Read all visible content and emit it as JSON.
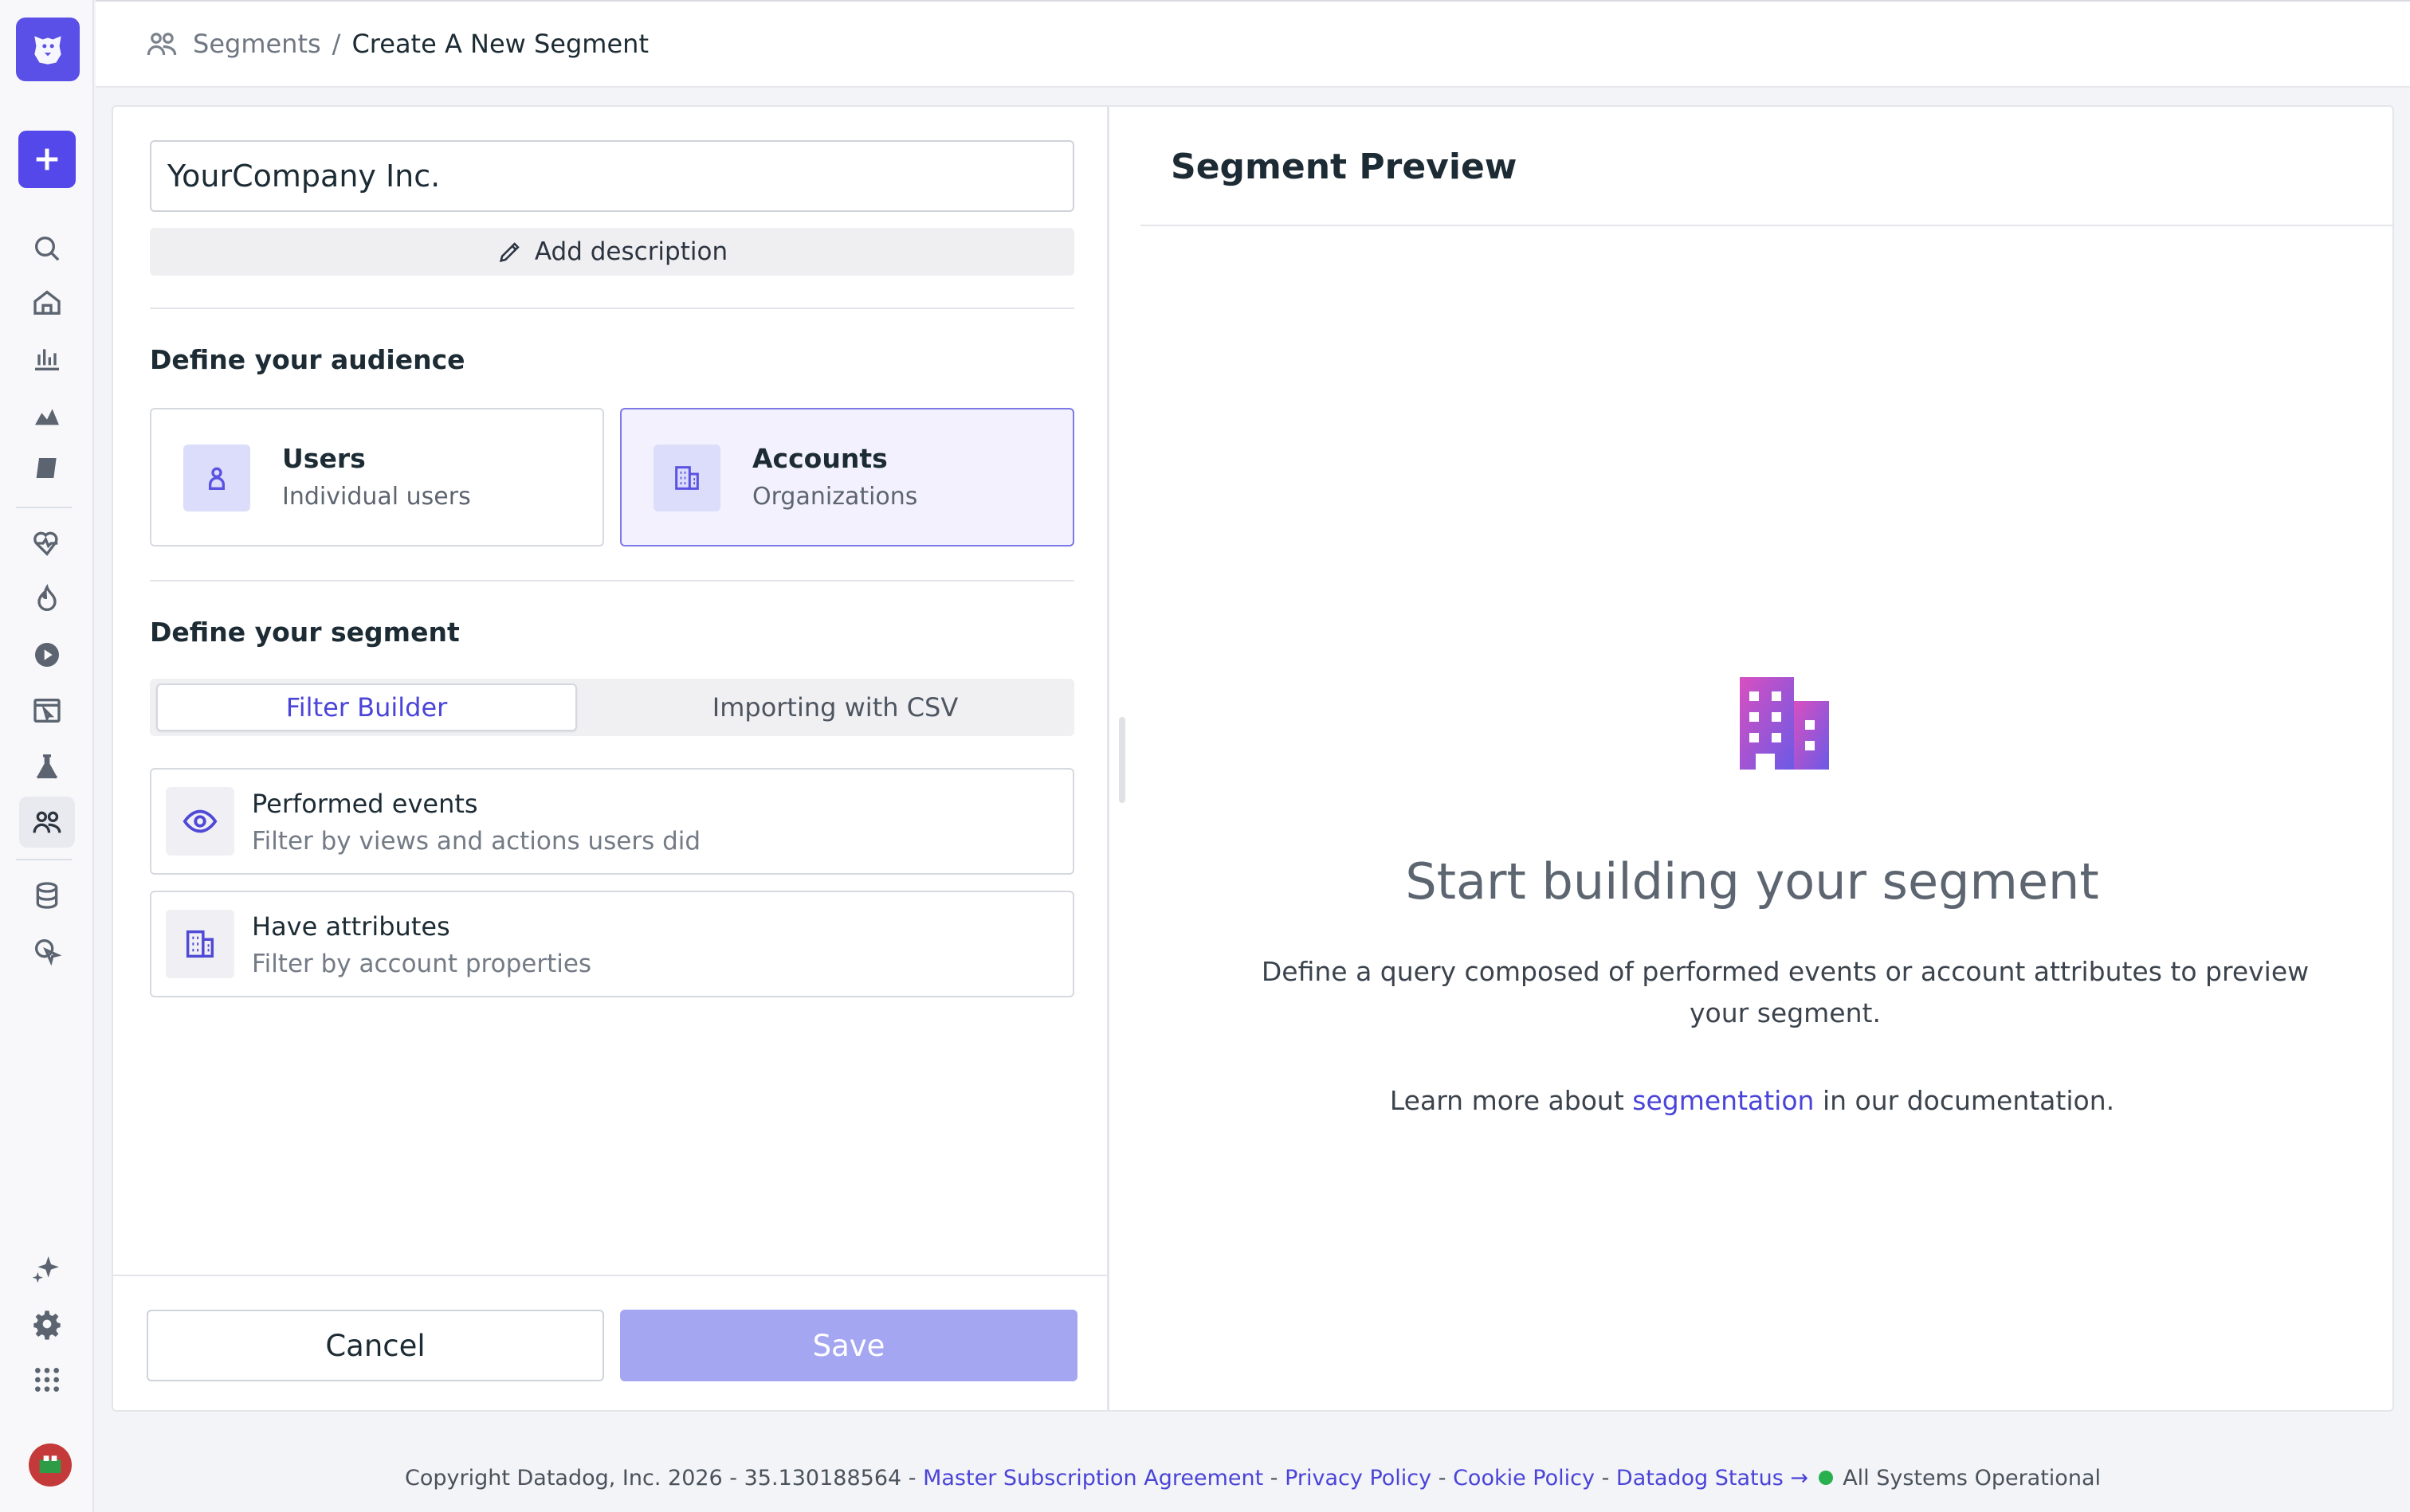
{
  "breadcrumb": {
    "root": "Segments",
    "separator": "/",
    "current": "Create A New Segment"
  },
  "form": {
    "name_value": "YourCompany Inc.",
    "add_description_label": "Add description",
    "audience_title": "Define your audience",
    "audience_options": [
      {
        "title": "Users",
        "subtitle": "Individual users",
        "selected": false
      },
      {
        "title": "Accounts",
        "subtitle": "Organizations",
        "selected": true
      }
    ],
    "segment_title": "Define your segment",
    "tabs": [
      {
        "label": "Filter Builder",
        "active": true
      },
      {
        "label": "Importing with CSV",
        "active": false
      }
    ],
    "filters": [
      {
        "title": "Performed events",
        "subtitle": "Filter by views and actions users did",
        "icon": "eye-icon"
      },
      {
        "title": "Have attributes",
        "subtitle": "Filter by account properties",
        "icon": "building-icon"
      }
    ],
    "cancel_label": "Cancel",
    "save_label": "Save"
  },
  "preview": {
    "title": "Segment Preview",
    "empty_title": "Start building your segment",
    "empty_desc": "Define a query composed of performed events or account attributes to preview your segment.",
    "learn_prefix": "Learn more about",
    "learn_link": "segmentation",
    "learn_suffix": "in our documentation."
  },
  "footer": {
    "copyright": "Copyright Datadog, Inc. 2026 - 35.130188564 -",
    "msa": "Master Subscription Agreement",
    "privacy": "Privacy Policy",
    "cookie": "Cookie Policy",
    "status_link": "Datadog Status →",
    "status_text": "All Systems Operational",
    "sep": "-"
  },
  "colors": {
    "accent": "#5448ea",
    "accent_light": "#a4a6f2",
    "status_ok": "#29b04e"
  }
}
